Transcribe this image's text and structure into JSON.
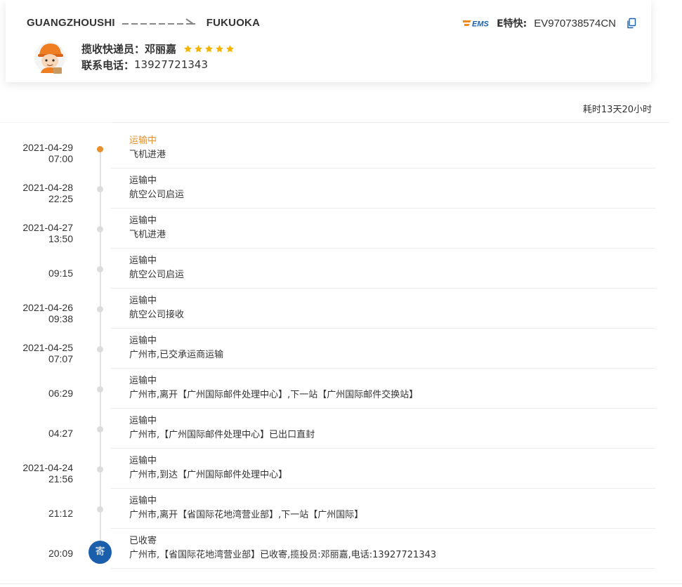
{
  "route": {
    "origin": "GUANGZHOUSHI",
    "destination": "FUKUOKA"
  },
  "courier": {
    "label": "揽收快递员：",
    "name": "邓丽嘉",
    "rating": 5,
    "phone_label": "联系电话：",
    "phone": "13927721343"
  },
  "shipment": {
    "carrier_logo": "EMS",
    "carrier": "E特快:",
    "tracking_number": "EV970738574CN"
  },
  "summary": {
    "duration": "耗时13天20小时"
  },
  "colors": {
    "accent": "#e8902e",
    "badge": "#1a5fac",
    "star": "#f5b400",
    "dot": "#dcdcdc"
  },
  "events": [
    {
      "date": "2021-04-29",
      "time": "07:00",
      "status": "运输中",
      "desc": "飞机进港",
      "active": true
    },
    {
      "date": "2021-04-28",
      "time": "22:25",
      "status": "运输中",
      "desc": "航空公司启运"
    },
    {
      "date": "2021-04-27",
      "time": "13:50",
      "status": "运输中",
      "desc": "飞机进港"
    },
    {
      "date": "",
      "time": "09:15",
      "status": "运输中",
      "desc": "航空公司启运"
    },
    {
      "date": "2021-04-26",
      "time": "09:38",
      "status": "运输中",
      "desc": "航空公司接收"
    },
    {
      "date": "2021-04-25",
      "time": "07:07",
      "status": "运输中",
      "desc": "广州市,已交承运商运输"
    },
    {
      "date": "",
      "time": "06:29",
      "status": "运输中",
      "desc": "广州市,离开【广州国际邮件处理中心】,下一站【广州国际邮件交换站】"
    },
    {
      "date": "",
      "time": "04:27",
      "status": "运输中",
      "desc": "广州市,【广州国际邮件处理中心】已出口直封"
    },
    {
      "date": "2021-04-24",
      "time": "21:56",
      "status": "运输中",
      "desc": "广州市,到达【广州国际邮件处理中心】"
    },
    {
      "date": "",
      "time": "21:12",
      "status": "运输中",
      "desc": "广州市,离开【省国际花地湾营业部】,下一站【广州国际】"
    },
    {
      "date": "",
      "time": "20:09",
      "status": "已收寄",
      "desc": "广州市,【省国际花地湾营业部】已收寄,揽投员:邓丽嘉,电话:13927721343",
      "badge": "寄"
    }
  ]
}
